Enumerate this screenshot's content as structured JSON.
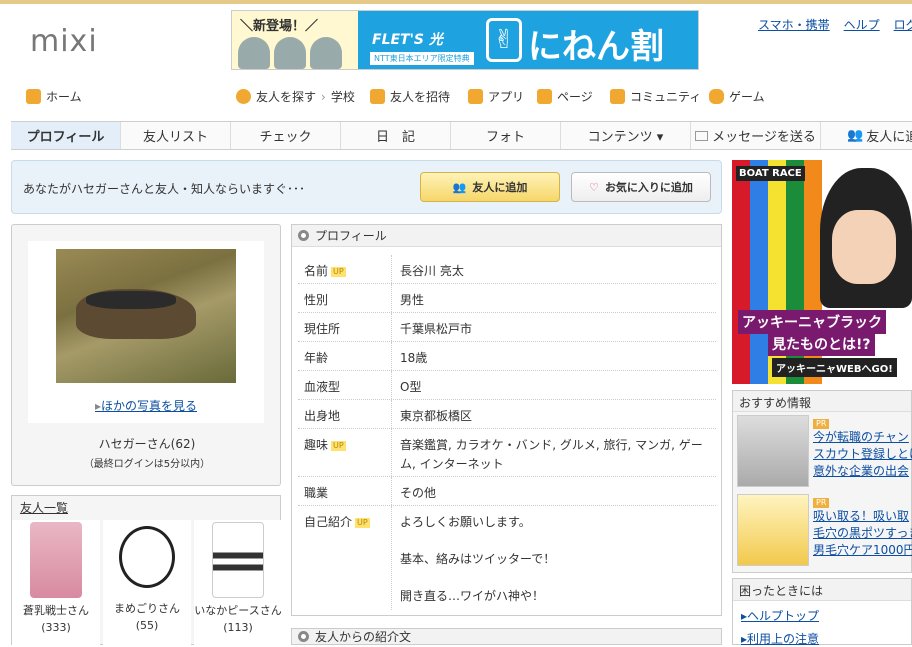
{
  "header": {
    "logo": "mixi",
    "banner": {
      "new_label": "＼新登場！／",
      "flets": "FLET'S 光",
      "ntt": "NTT東日本エリア限定特典",
      "campaign": "にねん割"
    },
    "links": [
      "スマホ・携帯",
      "ヘルプ",
      "ログ"
    ]
  },
  "nav": {
    "home": "ホーム",
    "find_friends": "友人を探す",
    "school": "学校",
    "invite": "友人を招待",
    "apps": "アプリ",
    "pages": "ページ",
    "community": "コミュニティ",
    "games": "ゲーム"
  },
  "tabs": [
    "プロフィール",
    "友人リスト",
    "チェック",
    "日　記",
    "フォト",
    "コンテンツ ▾",
    "メッセージを送る",
    "友人に追"
  ],
  "friend_prompt": {
    "text": "あなたがハセガーさんと友人・知人ならいますぐ･･･",
    "add_button": "友人に追加",
    "fav_button": "お気に入りに追加"
  },
  "user": {
    "more_photos": "ほかの写真を見る",
    "name": "ハセガーさん(62)",
    "last_login": "（最終ログインは5分以内）"
  },
  "friends": {
    "title": "友人一覧",
    "items": [
      {
        "name": "蒼乳戦士さん (333)"
      },
      {
        "name": "まめごりさん (55)"
      },
      {
        "name": "いなかピースさん (113)"
      }
    ]
  },
  "profile": {
    "title": "プロフィール",
    "up": "UP",
    "rows": [
      {
        "key": "名前",
        "value": "長谷川 亮太"
      },
      {
        "key": "性別",
        "value": "男性"
      },
      {
        "key": "現住所",
        "value": "千葉県松戸市"
      },
      {
        "key": "年齢",
        "value": "18歳"
      },
      {
        "key": "血液型",
        "value": "O型"
      },
      {
        "key": "出身地",
        "value": "東京都板橋区"
      },
      {
        "key": "趣味",
        "value": "音楽鑑賞, カラオケ・バンド, グルメ, 旅行, マンガ, ゲーム, インターネット"
      },
      {
        "key": "職業",
        "value": "その他"
      },
      {
        "key": "自己紹介",
        "value_lines": [
          "よろしくお願いします。",
          "基本、絡みはツイッターで！",
          "開き直る…ワイがハ神や！"
        ]
      }
    ]
  },
  "intro_section": "友人からの紹介文",
  "ad": {
    "boat": "BOAT RACE",
    "line1": "アッキーニャブラック",
    "line2": "見たものとは!?",
    "line3": "アッキーニャWEBへGO!"
  },
  "recommend": {
    "title": "おすすめ情報",
    "pr": "PR",
    "items": [
      {
        "lines": [
          "今が転職のチャン",
          "スカウト登録しとけ",
          "意外な企業の出会"
        ]
      },
      {
        "lines": [
          "吸い取る！吸い取",
          "毛穴の黒ポツすっき",
          "男毛穴ケア1000円"
        ]
      }
    ]
  },
  "help": {
    "title": "困ったときには",
    "links": [
      "ヘルプトップ",
      "利用上の注意"
    ]
  },
  "colors": {
    "link": "#0b4ea2",
    "accent": "#e4c989",
    "tab_active": "#e3eef8"
  }
}
